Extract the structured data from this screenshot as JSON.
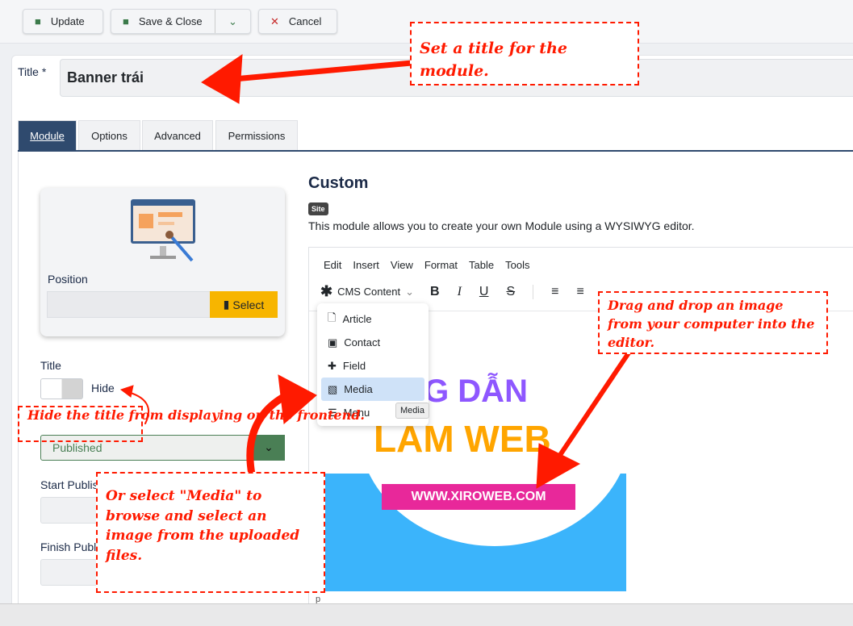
{
  "toolbar": {
    "update": "Update",
    "save_close": "Save & Close",
    "cancel": "Cancel"
  },
  "title_field": {
    "label": "Title *",
    "value": "Banner trái"
  },
  "tabs": [
    {
      "label": "Module",
      "active": true
    },
    {
      "label": "Options"
    },
    {
      "label": "Advanced"
    },
    {
      "label": "Permissions"
    }
  ],
  "position": {
    "label": "Position",
    "select": "Select"
  },
  "title_toggle": {
    "label": "Title",
    "state": "Hide"
  },
  "status": {
    "value": "Published"
  },
  "start_publishing": {
    "label": "Start Publis"
  },
  "finish_publishing": {
    "label": "Finish Publ"
  },
  "module": {
    "name": "Custom",
    "badge": "Site",
    "description": "This module allows you to create your own Module using a WYSIWYG editor."
  },
  "editor": {
    "menu": [
      "Edit",
      "Insert",
      "View",
      "Format",
      "Table",
      "Tools"
    ],
    "cms_content": "CMS Content",
    "dropdown": [
      "Article",
      "Contact",
      "Field",
      "Media",
      "Menu"
    ],
    "tooltip": "Media",
    "footer": "p"
  },
  "banner": {
    "line1": "ỨNG DẪN",
    "line2": "LAM WEB",
    "url": "WWW.XIROWEB.COM"
  },
  "annotations": {
    "title": "Set a title for the module.",
    "drag": "Drag and drop an image from your computer into the editor.",
    "hide": "Hide the title from displaying on the frontend.",
    "media": "Or select \"Media\" to browse and select an image from the uploaded files."
  },
  "colors": {
    "accent": "#2f4a6e",
    "annotation": "#ff1a00",
    "select_button": "#f7b500",
    "status_green": "#4a7f55"
  }
}
